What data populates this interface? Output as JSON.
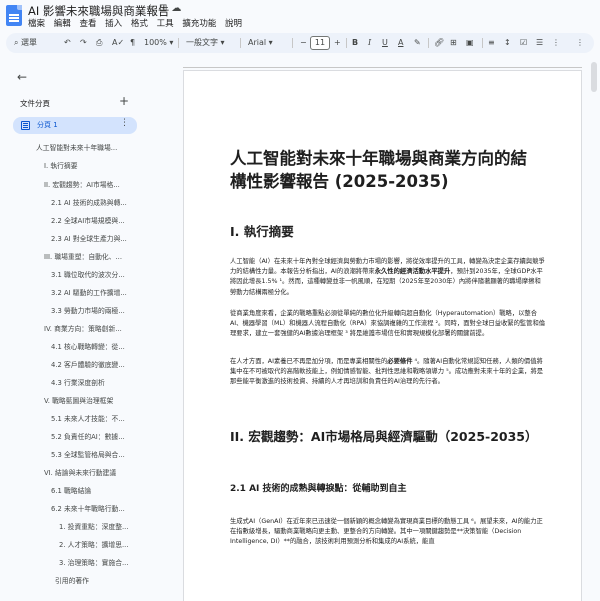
{
  "window": {
    "title": "AI 影響未來職場與商業報告",
    "menu": [
      "檔案",
      "編輯",
      "查看",
      "插入",
      "格式",
      "工具",
      "擴充功能",
      "說明"
    ]
  },
  "toolbar": {
    "search_menu": "選單",
    "zoom": "100%",
    "style": "一般文字",
    "font": "Arial",
    "font_size": "11"
  },
  "sidebar": {
    "outline_title": "文件分頁",
    "tab_label": "分頁 1",
    "items": [
      "人工智能對未來十年職場...",
      "I. 執行摘要",
      "II. 宏觀趨勢：AI市場格...",
      "2.1 AI 技術的成熟與轉...",
      "2.2 全球AI市場規模與...",
      "2.3 AI 對全球生產力與...",
      "III. 職場重塑：自動化、...",
      "3.1 職位取代的波次分...",
      "3.2 AI 驅動的工作擴增...",
      "3.3 勞動力市場的兩極...",
      "IV. 商業方向：策略創新...",
      "4.1 核心戰略轉變：從...",
      "4.2 客戶體驗的徹底變...",
      "4.3 行業深度剖析",
      "V. 戰略藍圖與治理框架",
      "5.1 未來人才技能：不...",
      "5.2 負責任的AI：數據...",
      "5.3 全球監管格局與合...",
      "VI. 結論與未來行動建議",
      "6.1 戰略結論",
      "6.2 未來十年戰略行動...",
      "1. 投資重點：深度整...",
      "2. 人才策略：擴增思...",
      "3. 治理策略：實施合...",
      "引用的著作"
    ]
  },
  "document": {
    "title": "人工智能對未來十年職場與商業方向的結構性影響報告 (2025-2035)",
    "h_exec": "I. 執行摘要",
    "p1_a": "人工智能（AI）在未來十年內對全球經濟與勞動力市場的影響，將從效率提升的工具，轉變為決定企業存續與競爭力的結構性力量。本報告分析指出，AI的浪潮將帶來",
    "p1_b": "永久性的經濟活動水平提升",
    "p1_c": "，預計到2035年，全球GDP水平將因此增長1.5% ¹。然而，這種轉變並非一帆風順，在短期（2025年至2030年）內將伴隨著顯著的職場摩擦和勞動力結構兩極分化。",
    "p2": "從商業角度來看，企業的戰略重點必須從單純的數位化升級轉向超自動化（Hyperautomation）戰略，以整合AI、機器學習（ML）和機器人流程自動化（RPA）來協調複雜的工作流程 ²。同時，面對全球日益收緊的監管和倫理要求，建立一套強健的AI數據治理框架 ³ 將是維護市場信任和實現規模化部署的關鍵前提。",
    "p3_a": "在人才方面，AI素養已不再是加分項，而是專業相關性的",
    "p3_b": "必要條件",
    "p3_c": " ⁴。隨著AI自動化常規認知任務，人類的價值將集中在不可被取代的高階軟技能上，例如情感智能、批判性思維和戰略領導力 ⁵。成功應對未來十年的企業，將是那些能平衡激進的技術投資、持續的人才再培訓和負責任的AI治理的先行者。",
    "h_trend": "II. 宏觀趨勢：AI市場格局與經濟驅動（2025-2035）",
    "h_21": "2.1 AI 技術的成熟與轉捩點：從輔助到自主",
    "p4": "生成式AI（GenAI）在近年來已迅速從一個新穎的概念轉變為實現商業目標的動態工具 ⁶。展望未來，AI的能力正在指數級增長，驅動商業戰略向更主動、更整合的方向轉變。其中一項關鍵趨勢是**決策智能（Decision Intelligence, DI）**的融合，該技術利用預測分析和集成的AI系統，能直"
  }
}
